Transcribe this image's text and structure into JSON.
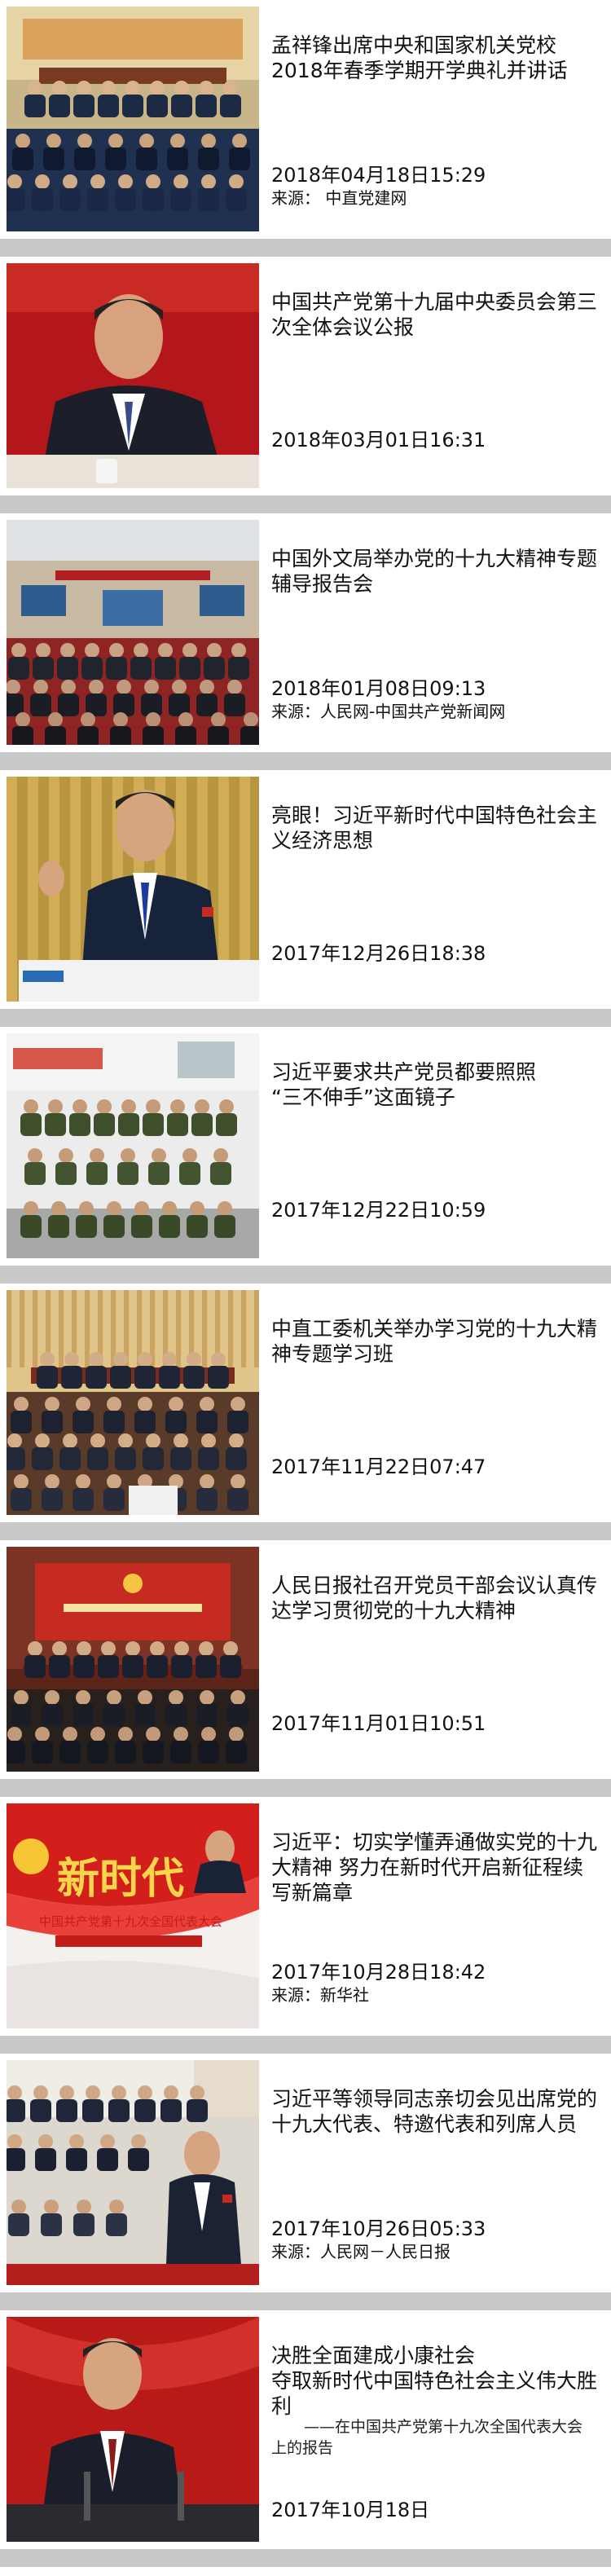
{
  "articles": [
    {
      "title": "孟祥锋出席中央和国家机关党校2018年春季学期开学典礼并讲话",
      "date": "2018年04月18日15:29",
      "source": "来源：  中直党建网",
      "scene": "meeting-hall-warm"
    },
    {
      "title": "中国共产党第十九届中央委员会第三次全体会议公报",
      "date": "2018年03月01日16:31",
      "source": "",
      "scene": "leader-red-portrait"
    },
    {
      "title": "中国外文局举办党的十九大精神专题辅导报告会",
      "date": "2018年01月08日09:13",
      "source": "来源：人民网-中国共产党新闻网",
      "scene": "auditorium-screens"
    },
    {
      "title": "亮眼！习近平新时代中国特色社会主义经济思想",
      "date": "2017年12月26日18:38",
      "source": "",
      "scene": "leader-speaking-gold"
    },
    {
      "title": "习近平要求共产党员都要照照\n“三不伸手”这面镜子",
      "date": "2017年12月22日10:59",
      "source": "",
      "scene": "military-group"
    },
    {
      "title": "中直工委机关举办学习党的十九大精神专题学习班",
      "date": "2017年11月22日07:47",
      "source": "",
      "scene": "conference-hall-wood"
    },
    {
      "title": "人民日报社召开党员干部会议认真传达学习贯彻党的十九大精神",
      "date": "2017年11月01日10:51",
      "source": "",
      "scene": "party-meeting-stage"
    },
    {
      "title": "习近平：切实学懂弄通做实党的十九大精神 努力在新时代开启新征程续写新篇章",
      "date": "2017年10月28日18:42",
      "source": "来源：新华社",
      "scene": "new-era-poster",
      "poster_big": "新时代",
      "poster_small": "中国共产党第十九次全国代表大会"
    },
    {
      "title": "习近平等领导同志亲切会见出席党的十九大代表、特邀代表和列席人员",
      "date": "2017年10月26日05:33",
      "source": "来源：人民网－人民日报",
      "scene": "handshake-crowd"
    },
    {
      "title": "决胜全面建成小康社会\n夺取新时代中国特色社会主义伟大胜利",
      "subtitle": "——在中国共产党第十九次全国代表大会上的报告",
      "date": "2017年10月18日",
      "source": "",
      "scene": "leader-podium-red"
    }
  ]
}
